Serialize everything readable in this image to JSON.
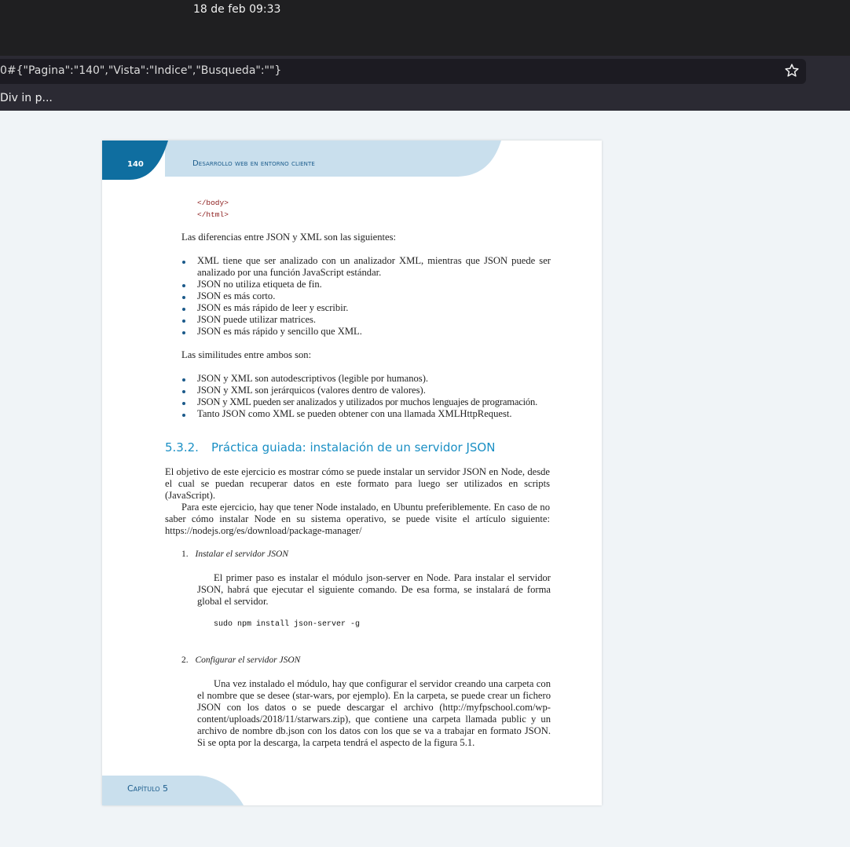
{
  "system": {
    "clock": "18 de feb  09:33"
  },
  "browser": {
    "url": "0#{\"Pagina\":\"140\",\"Vista\":\"Indice\",\"Busqueda\":\"\"}",
    "bookmark": "Div in p..."
  },
  "page": {
    "number": "140",
    "header_title": "Desarrollo web en entorno cliente",
    "code_end": [
      "</body>",
      "</html>"
    ],
    "differences_intro": "Las diferencias entre JSON y XML son las siguientes:",
    "differences": [
      "XML tiene que ser analizado con un analizador XML, mientras que JSON puede ser analizado por una función JavaScript estándar.",
      "JSON no utiliza etiqueta de fin.",
      "JSON es más corto.",
      "JSON es más rápido de leer y escribir.",
      "JSON puede utilizar matrices.",
      "JSON es más rápido y sencillo que XML."
    ],
    "similarities_intro": "Las similitudes entre ambos son:",
    "similarities": [
      "JSON y XML son autodescriptivos (legible por humanos).",
      "JSON y XML son jerárquicos (valores dentro de valores).",
      "JSON y XML pueden ser analizados y utilizados por muchos lenguajes de programación.",
      "Tanto JSON como XML se pueden obtener con una llamada XMLHttpRequest."
    ],
    "section_number": "5.3.2.",
    "section_title": "Práctica guiada: instalación de un servidor JSON",
    "intro_p1": "El objetivo de este ejercicio es mostrar cómo se puede instalar un servidor JSON en Node, desde el cual se puedan recuperar datos en este formato para luego ser utilizados en scripts (JavaScript).",
    "intro_p2": "Para este ejercicio, hay que tener Node instalado, en Ubuntu preferiblemente. En caso de no saber cómo instalar Node en su sistema operativo, se puede visite el artículo siguiente: https://nodejs.org/es/download/package-manager/",
    "step1_num": "1.",
    "step1_title": "Instalar el servidor JSON",
    "step1_text": "El primer paso es instalar el módulo json-server en Node. Para instalar el servidor JSON, habrá que ejecutar el siguiente comando. De esa forma, se instalará de forma global el servidor.",
    "step1_cmd": "sudo npm install json-server -g",
    "step2_num": "2.",
    "step2_title": "Configurar el servidor JSON",
    "step2_text": "Una vez instalado el módulo, hay que configurar el servidor creando una carpeta con el nombre que se desee (star-wars, por ejemplo). En la carpeta, se puede crear un fichero JSON con los datos o se puede descargar el archivo (http://myfpschool.com/wp-content/uploads/2018/11/starwars.zip), que contiene una carpeta llamada public y un archivo de nombre db.json con los datos con los que se va a trabajar en formato JSON. Si se opta por la descarga, la carpeta tendrá el aspecto de la figura 5.1.",
    "footer_chapter": "Capítulo 5"
  },
  "colors": {
    "accent": "#0f6ea0",
    "band": "#c9dfed",
    "heading": "#1a8fc4"
  },
  "icons": {
    "bookmark_star": "star-icon"
  }
}
